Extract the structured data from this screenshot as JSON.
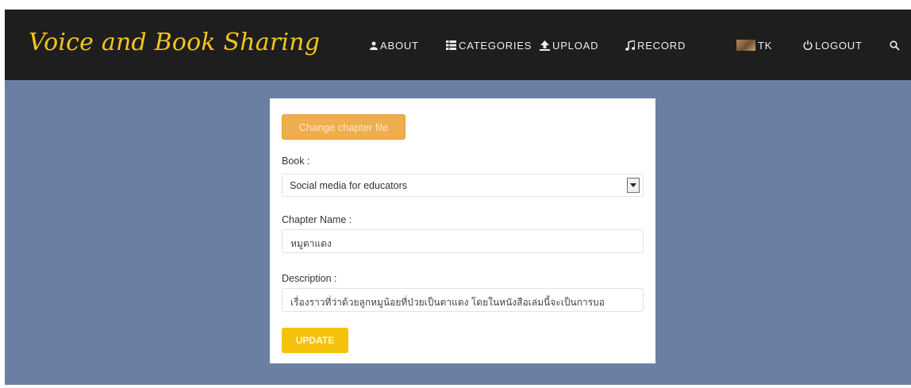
{
  "nav": {
    "brand": "Voice and Book Sharing",
    "items": [
      {
        "label": "ABOUT",
        "icon": "user-icon"
      },
      {
        "label": "CATEGORIES",
        "icon": "list-icon"
      },
      {
        "label": "UPLOAD",
        "icon": "upload-icon"
      },
      {
        "label": "RECORD",
        "icon": "music-note-icon"
      },
      {
        "label": "TK",
        "icon": "avatar"
      },
      {
        "label": "LOGOUT",
        "icon": "power-icon"
      }
    ],
    "search_icon": "search-icon"
  },
  "form": {
    "change_button": "Change chapter file",
    "book_label": "Book :",
    "book_value": "Social media for educators",
    "chapter_label": "Chapter Name :",
    "chapter_value": "หมูตาแดง",
    "description_label": "Description :",
    "description_value": "เรื่องราวที่ว่าด้วยลูกหมูน้อยที่ป่วยเป็นตาแดง โดยในหนังสือเล่มนี้จะเป็นการบอ",
    "update_button": "UPDATE"
  },
  "colors": {
    "navbar": "#1e1e1e",
    "brand": "#f2c51c",
    "background": "#6b7fa2",
    "change_button": "#f0ad4e",
    "update_button": "#f4c20d"
  }
}
